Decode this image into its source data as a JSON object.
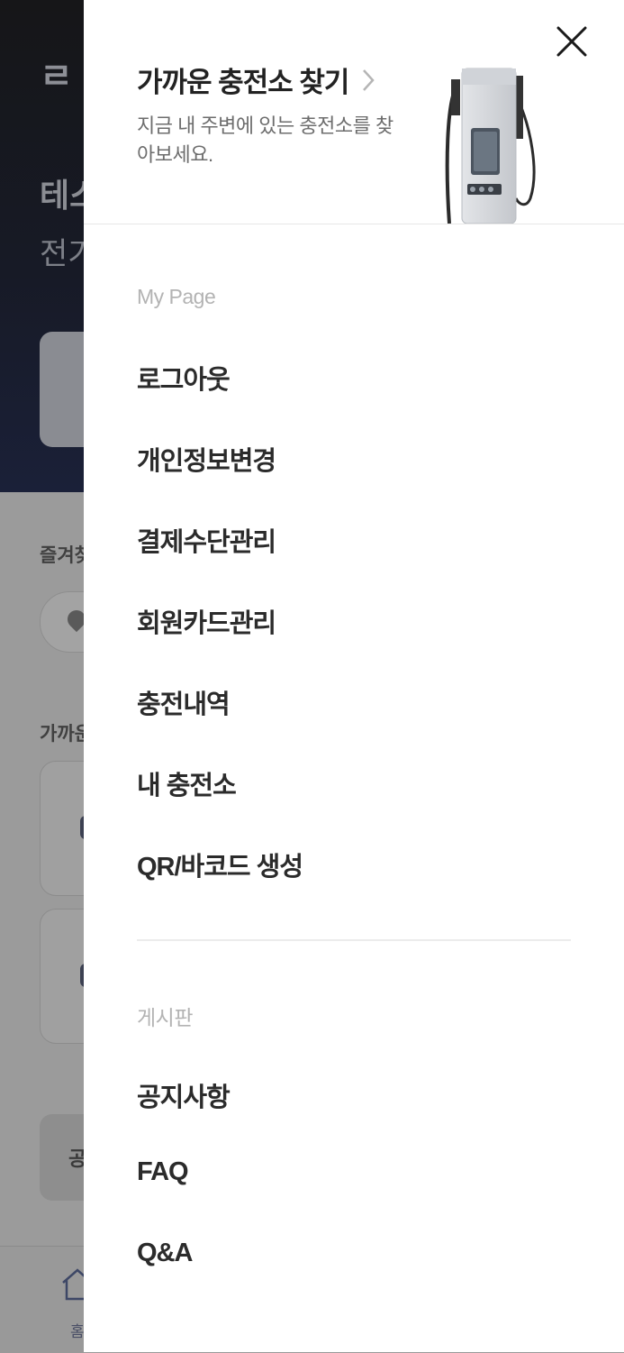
{
  "background": {
    "logo": "ㄹ",
    "hero_title": "테스",
    "hero_subtitle": "전기",
    "favorites_label": "즐겨찾",
    "nearby_label": "가까운",
    "notice_button": "공",
    "tab_home_label": "홈"
  },
  "drawer": {
    "promo": {
      "title": "가까운 충전소 찾기",
      "description": "지금 내 주변에 있는 충전소를 찾아보세요."
    },
    "my_page": {
      "label": "My Page",
      "items": [
        "로그아웃",
        "개인정보변경",
        "결제수단관리",
        "회원카드관리",
        "충전내역",
        "내 충전소",
        "QR/바코드 생성"
      ]
    },
    "board": {
      "label": "게시판",
      "items": [
        "공지사항",
        "FAQ",
        "Q&A"
      ]
    }
  },
  "colors": {
    "overlay_dim": "#9a9a9a",
    "drawer_bg": "#ffffff",
    "menu_text": "#2b2b2b",
    "section_label": "#b3b3b3"
  },
  "icons": {
    "close": "close-icon",
    "chevron": "chevron-right-icon",
    "home": "home-icon",
    "pin": "ev-pin-icon"
  }
}
